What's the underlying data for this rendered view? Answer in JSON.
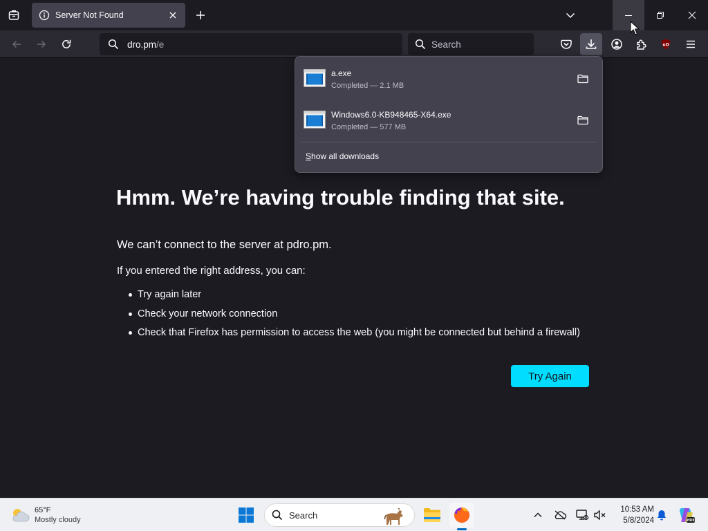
{
  "tab": {
    "title": "Server Not Found"
  },
  "urlbar": {
    "host": "dro.pm",
    "path": "/e"
  },
  "searchbar": {
    "placeholder": "Search"
  },
  "error": {
    "title": "Hmm. We’re having trouble finding that site.",
    "description": "We can’t connect to the server at pdro.pm.",
    "intro": "If you entered the right address, you can:",
    "suggestions": [
      "Try again later",
      "Check your network connection",
      "Check that Firefox has permission to access the web (you might be connected but behind a firewall)"
    ],
    "try_again_label": "Try Again"
  },
  "downloads": {
    "items": [
      {
        "name": "a.exe",
        "status": "Completed — 2.1 MB"
      },
      {
        "name": "Windows6.0-KB948465-X64.exe",
        "status": "Completed — 577 MB"
      }
    ],
    "show_all_label_first": "S",
    "show_all_label_rest": "how all downloads"
  },
  "taskbar": {
    "weather": {
      "temp": "65°F",
      "condition": "Mostly cloudy"
    },
    "search_label": "Search",
    "clock": {
      "time": "10:53 AM",
      "date": "5/8/2024"
    }
  },
  "icons": {
    "tablist": "tab-list-icon",
    "info": "info-icon",
    "close": "close-icon",
    "new_tab": "plus-icon",
    "all_tabs": "chevron-down-icon",
    "back": "back-arrow-icon",
    "forward": "forward-arrow-icon",
    "reload": "reload-icon",
    "search": "search-icon",
    "pocket": "pocket-icon",
    "downloads": "download-icon",
    "account": "account-icon",
    "extensions": "puzzle-icon",
    "ublock": "ublock-origin-icon",
    "menu": "hamburger-menu-icon",
    "folder": "folder-icon"
  },
  "colors": {
    "page_bg": "#1c1b22",
    "toolbar_bg": "#2b2a33",
    "panel_bg": "#42414d",
    "accent_button": "#00ddff",
    "taskbar_bg": "#eef0f4"
  }
}
